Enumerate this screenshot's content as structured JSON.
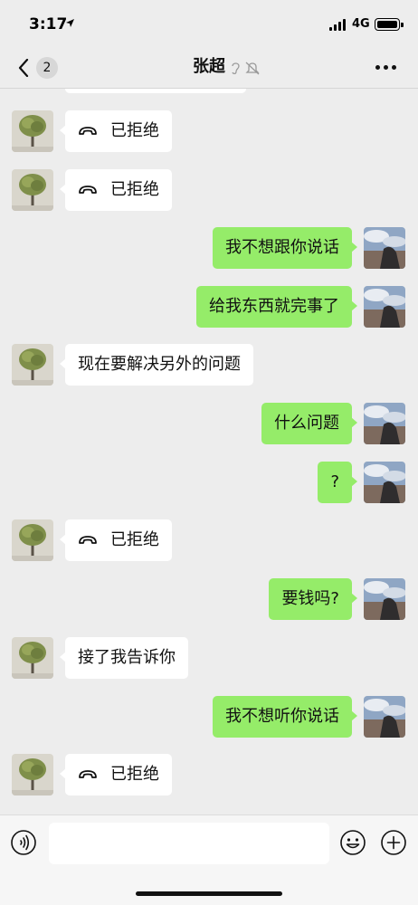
{
  "status_bar": {
    "time": "3:17",
    "network": "4G"
  },
  "header": {
    "back_count": "2",
    "title": "张超"
  },
  "messages": [
    {
      "side": "in",
      "type": "call",
      "text": "已拒绝"
    },
    {
      "side": "in",
      "type": "call",
      "text": "已拒绝"
    },
    {
      "side": "out",
      "type": "text",
      "text": "我不想跟你说话"
    },
    {
      "side": "out",
      "type": "text",
      "text": "给我东西就完事了"
    },
    {
      "side": "in",
      "type": "text",
      "text": "现在要解决另外的问题"
    },
    {
      "side": "out",
      "type": "text",
      "text": "什么问题"
    },
    {
      "side": "out",
      "type": "text",
      "text": "?"
    },
    {
      "side": "in",
      "type": "call",
      "text": "已拒绝"
    },
    {
      "side": "out",
      "type": "text",
      "text": "要钱吗?"
    },
    {
      "side": "in",
      "type": "text",
      "text": "接了我告诉你"
    },
    {
      "side": "out",
      "type": "text",
      "text": "我不想听你说话"
    },
    {
      "side": "in",
      "type": "call",
      "text": "已拒绝"
    }
  ],
  "icons": {
    "back": "chevron-left-icon",
    "call": "phone-hangup-icon",
    "more": "more-dots-icon",
    "voice": "voice-icon",
    "emoji": "emoji-icon",
    "plus": "plus-icon"
  },
  "colors": {
    "outgoing_bubble": "#95ec69",
    "incoming_bubble": "#ffffff",
    "background": "#ededed"
  }
}
